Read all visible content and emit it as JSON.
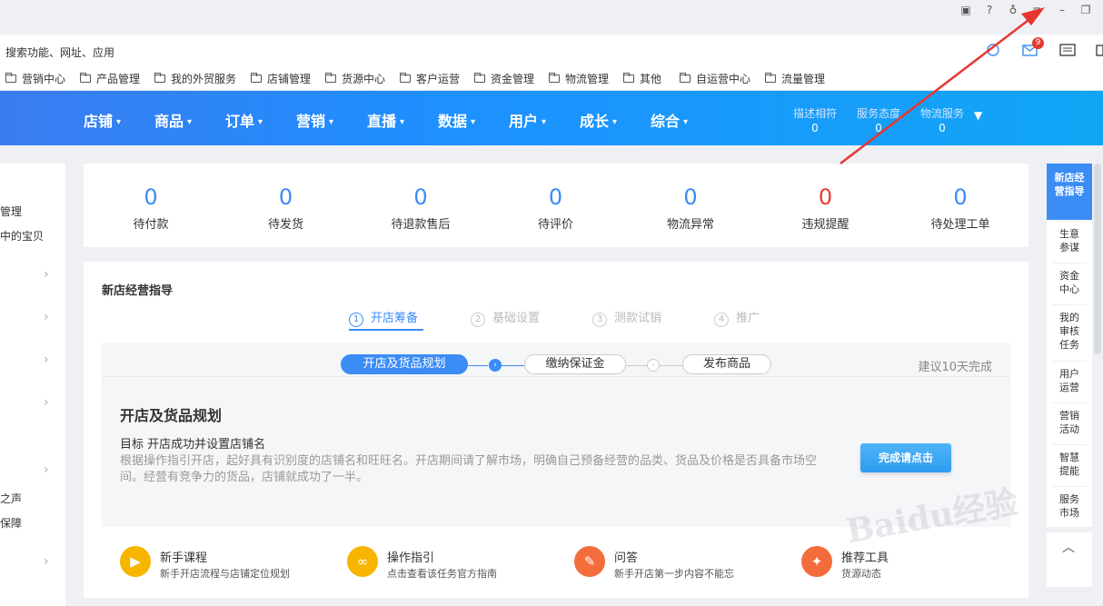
{
  "address_bar": {
    "placeholder": "搜索功能、网址、应用",
    "mail_badge": "9"
  },
  "bookmarks": [
    "营销中心",
    "产品管理",
    "我的外贸服务",
    "店铺管理",
    "货源中心",
    "客户运营",
    "资金管理",
    "物流管理",
    "其他",
    "自运营中心",
    "流量管理"
  ],
  "nav": {
    "items": [
      "店铺",
      "商品",
      "订单",
      "营销",
      "直播",
      "数据",
      "用户",
      "成长",
      "综合"
    ],
    "stats": [
      {
        "label": "描述相符",
        "value": "0"
      },
      {
        "label": "服务态度",
        "value": "0"
      },
      {
        "label": "物流服务",
        "value": "0"
      }
    ]
  },
  "sidebar": {
    "items": [
      "管理",
      "中的宝贝",
      "之声",
      "保障"
    ]
  },
  "counters": [
    {
      "value": "0",
      "label": "待付款",
      "color": "#3b8cf5"
    },
    {
      "value": "0",
      "label": "待发货",
      "color": "#3b8cf5"
    },
    {
      "value": "0",
      "label": "待退款售后",
      "color": "#3b8cf5"
    },
    {
      "value": "0",
      "label": "待评价",
      "color": "#3b8cf5"
    },
    {
      "value": "0",
      "label": "物流异常",
      "color": "#3b8cf5"
    },
    {
      "value": "0",
      "label": "违规提醒",
      "color": "#e8392f"
    },
    {
      "value": "0",
      "label": "待处理工单",
      "color": "#3b8cf5"
    }
  ],
  "guide": {
    "title": "新店经营指导",
    "steps": [
      {
        "num": "1",
        "label": "开店筹备"
      },
      {
        "num": "2",
        "label": "基础设置"
      },
      {
        "num": "3",
        "label": "测款试销"
      },
      {
        "num": "4",
        "label": "推广"
      }
    ],
    "substeps": [
      "开店及货品规划",
      "缴纳保证金",
      "发布商品"
    ],
    "suggest": "建议10天完成",
    "task_title": "开店及货品规划",
    "goal": "目标 开店成功并设置店铺名",
    "desc": "根据操作指引开店，起好具有识别度的店铺名和旺旺名。开店期间请了解市场，明确自己预备经营的品类、货品及价格是否具备市场空间。经营有竞争力的货品，店铺就成功了一半。",
    "done_button": "完成请点击",
    "resources": [
      {
        "title": "新手课程",
        "desc": "新手开店流程与店铺定位规划",
        "icon": "play-icon",
        "color": "#f7b500"
      },
      {
        "title": "操作指引",
        "desc": "点击查看该任务官方指南",
        "icon": "link-icon",
        "color": "#f7b500"
      },
      {
        "title": "问答",
        "desc": "新手开店第一步内容不能忘",
        "icon": "pencil-icon",
        "color": "#f36d3c"
      },
      {
        "title": "推荐工具",
        "desc": "货源动态",
        "icon": "wrench-icon",
        "color": "#f36d3c"
      }
    ]
  },
  "right_panel": {
    "items": [
      "新店经营指导",
      "生意参谋",
      "资金中心",
      "我的审核任务",
      "用户运营",
      "营销活动",
      "智慧提能",
      "服务市场"
    ]
  },
  "watermark": "Baidu经验"
}
